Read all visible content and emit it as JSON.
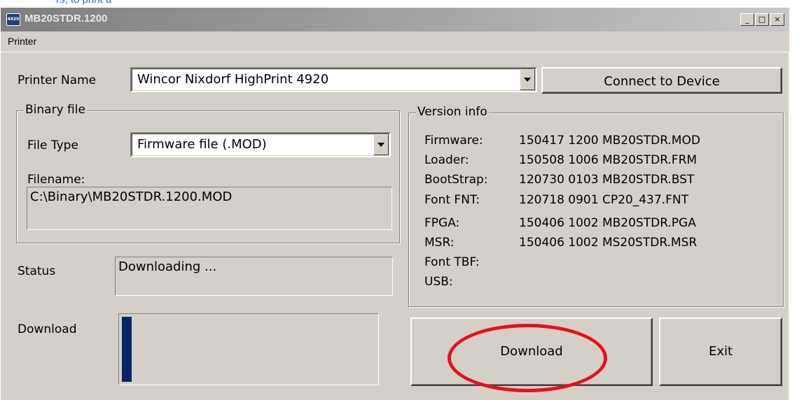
{
  "top_link": "rs, to print a",
  "window": {
    "title": "MB20STDR.1200",
    "icon_text": "4920",
    "controls": {
      "minimize": "_",
      "maximize": "□",
      "close": "×"
    }
  },
  "menu": {
    "items": [
      "Printer"
    ]
  },
  "printer": {
    "label": "Printer Name",
    "selected": "Wincor Nixdorf HighPrint 4920",
    "connect_button": "Connect to Device"
  },
  "binary_file": {
    "title": "Binary file",
    "file_type_label": "File Type",
    "file_type_selected": "Firmware file (.MOD)",
    "filename_label": "Filename:",
    "filename_value": "C:\\Binary\\MB20STDR.1200.MOD"
  },
  "status": {
    "label": "Status",
    "value": "Downloading ..."
  },
  "download": {
    "label": "Download",
    "progress": 0.04
  },
  "version_info": {
    "title": "Version info",
    "rows": [
      {
        "key": "Firmware:",
        "value": "150417 1200 MB20STDR.MOD"
      },
      {
        "key": "Loader:",
        "value": "150508 1006 MB20STDR.FRM"
      },
      {
        "key": "BootStrap:",
        "value": "120730 0103 MB20STDR.BST"
      },
      {
        "key": "Font FNT:",
        "value": "120718 0901 CP20_437.FNT"
      },
      {
        "key": "FPGA:",
        "value": "150406 1002 MB20STDR.PGA"
      },
      {
        "key": "MSR:",
        "value": "150406 1002 MS20STDR.MSR"
      },
      {
        "key": "Font  TBF:",
        "value": ""
      },
      {
        "key": "USB:",
        "value": ""
      }
    ]
  },
  "buttons": {
    "download": "Download",
    "exit": "Exit"
  },
  "colors": {
    "progress_fill": "#0a246a",
    "highlight_ellipse": "#e8101a",
    "dialog_face": "#d4d0c8"
  }
}
